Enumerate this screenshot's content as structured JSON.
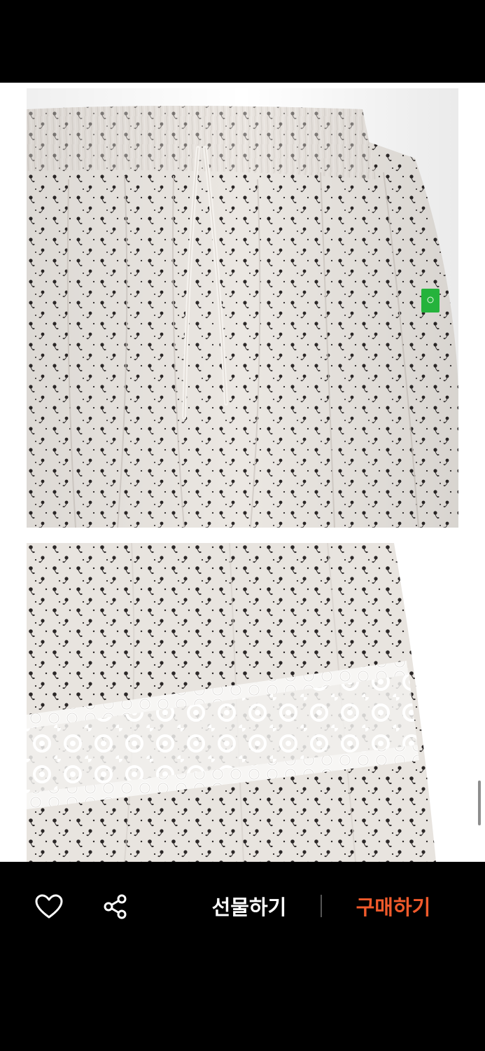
{
  "colors": {
    "background": "#000000",
    "fabric": "#ebe7e2",
    "print": "#2b2727",
    "tag": "#25b33c",
    "buy_accent": "#f15a2b"
  },
  "product_images": [
    {
      "name": "skirt-waistband-detail"
    },
    {
      "name": "skirt-lace-hem-detail"
    }
  ],
  "scroll_top": {
    "icon": "chevron-up-icon"
  },
  "actions": {
    "like_icon": "heart-icon",
    "share_icon": "share-icon",
    "gift_label": "선물하기",
    "buy_label": "구매하기"
  }
}
